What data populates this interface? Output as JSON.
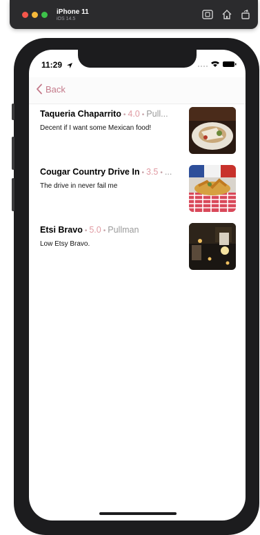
{
  "simulator": {
    "device_name": "iPhone 11",
    "os_version": "iOS 14.5",
    "icons": [
      "screenshot-icon",
      "home-icon",
      "rotate-icon"
    ]
  },
  "status_bar": {
    "time": "11:29"
  },
  "nav": {
    "back_label": "Back"
  },
  "restaurants": [
    {
      "name": "Taqueria Chaparrito",
      "rating": "4.0",
      "city": "Pull...",
      "review": "Decent if I want some Mexican food!"
    },
    {
      "name": "Cougar Country Drive In",
      "rating": "3.5",
      "city": "...",
      "review": "The drive in never fail me"
    },
    {
      "name": "Etsi Bravo",
      "rating": "5.0",
      "city": "Pullman",
      "review": "Low Etsy Bravo."
    }
  ],
  "colors": {
    "accent": "#c47a8a",
    "rating": "#e09aa2",
    "toolbar": "#2b2b2d"
  }
}
